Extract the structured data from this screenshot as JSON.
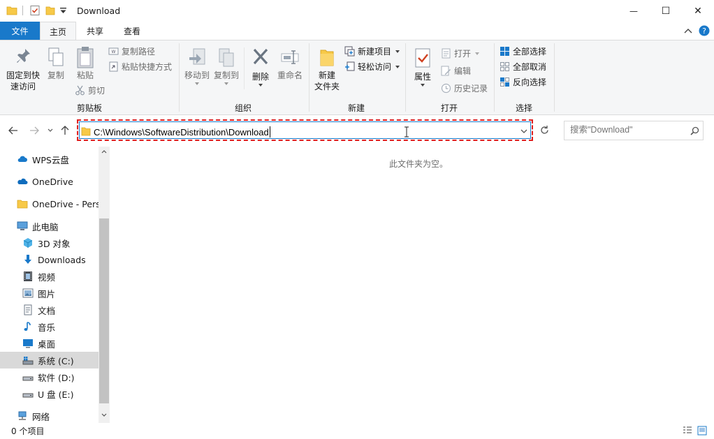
{
  "window": {
    "title": "Download",
    "minimize": "—",
    "maximize": "☐",
    "close": "✕"
  },
  "ribbon_tabs": {
    "file": "文件",
    "home": "主页",
    "share": "共享",
    "view": "查看"
  },
  "ribbon": {
    "clipboard": {
      "pin_line1": "固定到快",
      "pin_line2": "速访问",
      "copy": "复制",
      "paste": "粘贴",
      "copy_path": "复制路径",
      "paste_shortcut": "粘贴快捷方式",
      "cut": "剪切",
      "group": "剪贴板"
    },
    "organize": {
      "move_to": "移动到",
      "copy_to": "复制到",
      "delete": "删除",
      "rename": "重命名",
      "group": "组织"
    },
    "new": {
      "new_folder_line1": "新建",
      "new_folder_line2": "文件夹",
      "new_item": "新建项目",
      "easy_access": "轻松访问",
      "group": "新建"
    },
    "open": {
      "properties": "属性",
      "open": "打开",
      "edit": "编辑",
      "history": "历史记录",
      "group": "打开"
    },
    "select": {
      "select_all": "全部选择",
      "select_none": "全部取消",
      "invert": "反向选择",
      "group": "选择"
    }
  },
  "address": {
    "path": "C:\\Windows\\SoftwareDistribution\\Download"
  },
  "search": {
    "placeholder": "搜索\"Download\""
  },
  "nav_pane": {
    "items": [
      {
        "label": "WPS云盘",
        "icon": "cloud-icon"
      },
      {
        "label": "OneDrive",
        "icon": "onedrive-icon"
      },
      {
        "label": "OneDrive - Perso",
        "icon": "folder-icon"
      },
      {
        "label": "此电脑",
        "icon": "computer-icon"
      },
      {
        "label": "3D 对象",
        "icon": "cube-icon"
      },
      {
        "label": "Downloads",
        "icon": "download-arrow-icon"
      },
      {
        "label": "视频",
        "icon": "film-icon"
      },
      {
        "label": "图片",
        "icon": "picture-icon"
      },
      {
        "label": "文档",
        "icon": "document-icon"
      },
      {
        "label": "音乐",
        "icon": "music-note-icon"
      },
      {
        "label": "桌面",
        "icon": "desktop-icon"
      },
      {
        "label": "系统 (C:)",
        "icon": "system-drive-icon"
      },
      {
        "label": "软件 (D:)",
        "icon": "drive-icon"
      },
      {
        "label": "U 盘 (E:)",
        "icon": "drive-icon"
      },
      {
        "label": "网络",
        "icon": "network-icon"
      }
    ]
  },
  "content": {
    "empty_message": "此文件夹为空。"
  },
  "status": {
    "item_count": "0 个项目"
  },
  "colors": {
    "accent": "#1979ca",
    "highlight_border": "#e02020",
    "folder_yellow": "#f7c948"
  }
}
